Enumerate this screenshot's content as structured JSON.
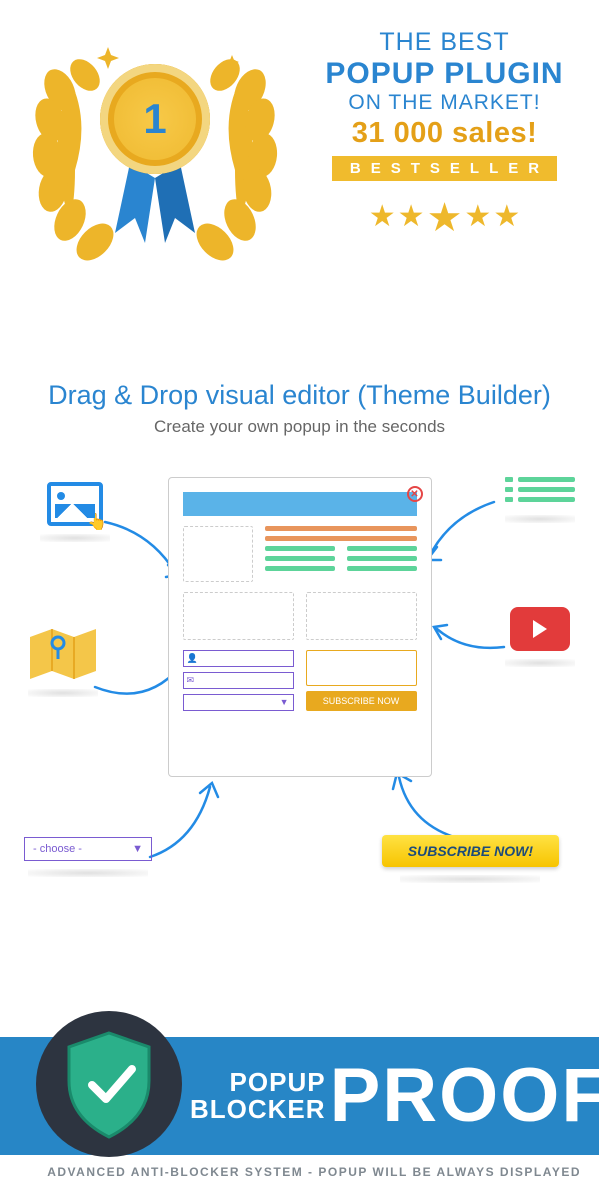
{
  "hero": {
    "medal_number": "1",
    "line1": "THE BEST",
    "line2": "POPUP PLUGIN",
    "line3": "ON THE MARKET!",
    "line4": "31 000 sales!",
    "bestseller": "BESTSELLER"
  },
  "editor": {
    "title": "Drag & Drop visual editor (Theme Builder)",
    "subtitle": "Create your own popup in the seconds"
  },
  "mockup": {
    "subscribe_small": "SUBSCRIBE NOW"
  },
  "widgets": {
    "select_placeholder": "- choose -",
    "subscribe_big": "SUBSCRIBE NOW!"
  },
  "proof": {
    "small_line1": "POPUP",
    "small_line2": "BLOCKER",
    "big": "PROOF",
    "footer": "ADVANCED ANTI-BLOCKER SYSTEM - POPUP WILL BE ALWAYS DISPLAYED"
  }
}
